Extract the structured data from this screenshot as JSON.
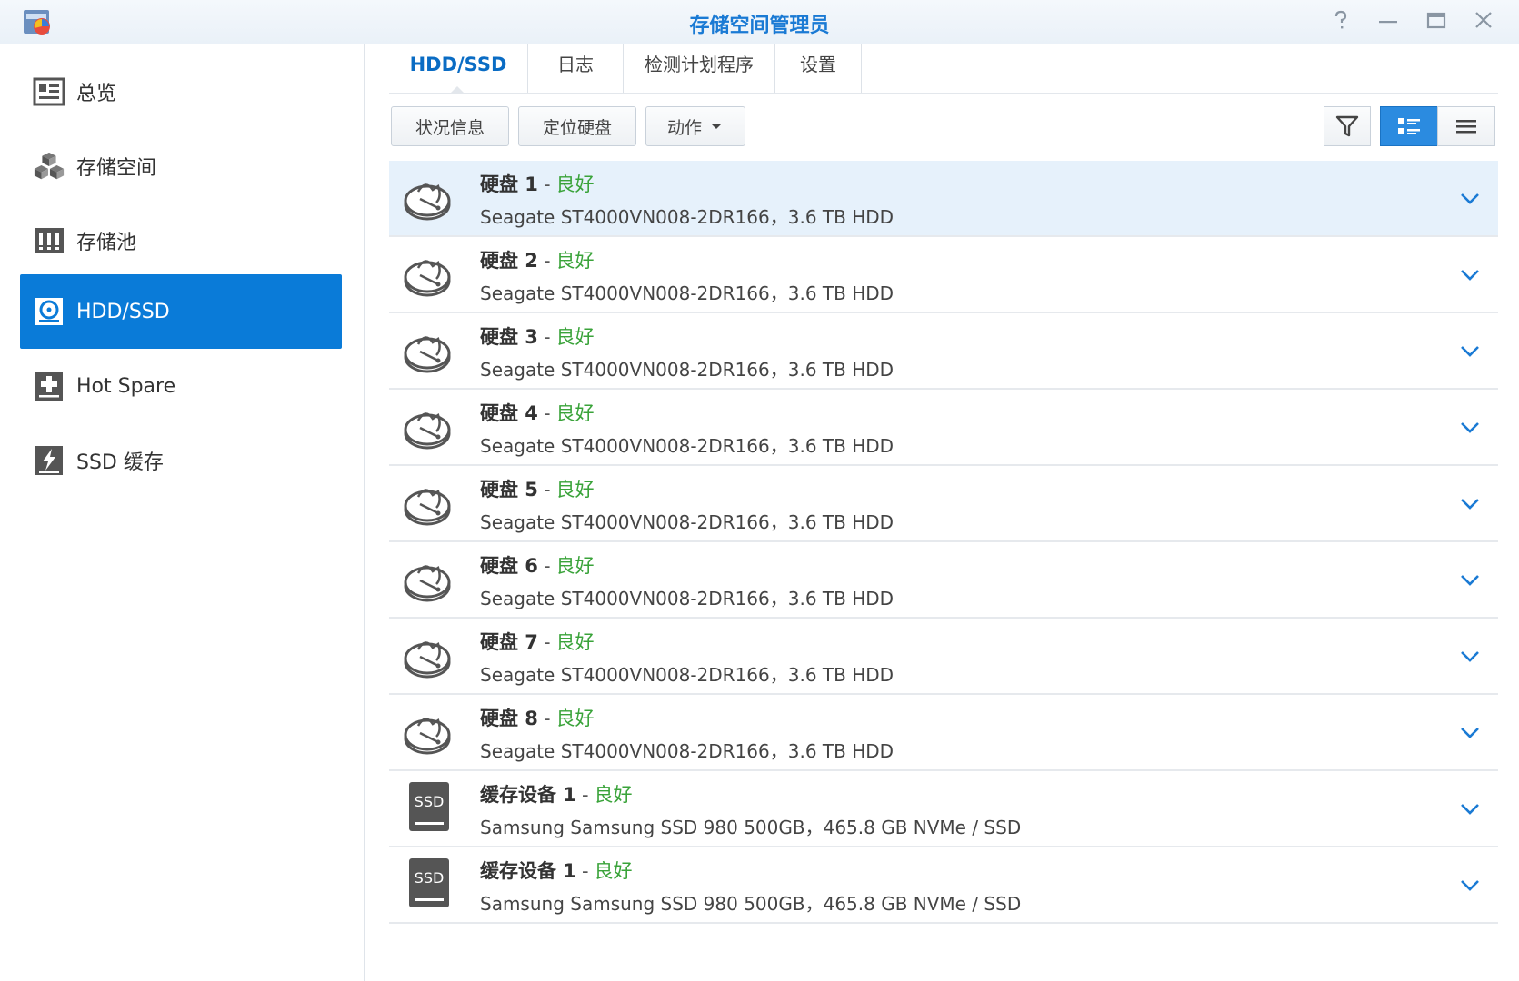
{
  "window": {
    "title": "存储空间管理员",
    "controls": [
      "help-icon",
      "minimize-icon",
      "maximize-icon",
      "close-icon"
    ]
  },
  "sidebar": {
    "items": [
      {
        "label": "总览",
        "icon": "overview-icon",
        "active": false
      },
      {
        "label": "存储空间",
        "icon": "cubes-icon",
        "active": false
      },
      {
        "label": "存储池",
        "icon": "pool-icon",
        "active": false
      },
      {
        "label": "HDD/SSD",
        "icon": "disk-icon",
        "active": true
      },
      {
        "label": "Hot Spare",
        "icon": "plus-box-icon",
        "active": false
      },
      {
        "label": "SSD 缓存",
        "icon": "flash-icon",
        "active": false
      }
    ]
  },
  "tabs": [
    {
      "label": "HDD/SSD",
      "active": true
    },
    {
      "label": "日志",
      "active": false
    },
    {
      "label": "检测计划程序",
      "active": false
    },
    {
      "label": "设置",
      "active": false
    }
  ],
  "toolbar": {
    "status_info": "状况信息",
    "locate_disk": "定位硬盘",
    "action": "动作",
    "tools": [
      "filter-icon",
      "detail-view-icon",
      "list-view-icon"
    ]
  },
  "accent_color": "#0a7bd8",
  "status_color": "#3aa33a",
  "devices": [
    {
      "name": "硬盘 1",
      "status": "良好",
      "detail": "Seagate ST4000VN008-2DR166，3.6 TB HDD",
      "type": "hdd",
      "selected": true
    },
    {
      "name": "硬盘 2",
      "status": "良好",
      "detail": "Seagate ST4000VN008-2DR166，3.6 TB HDD",
      "type": "hdd",
      "selected": false
    },
    {
      "name": "硬盘 3",
      "status": "良好",
      "detail": "Seagate ST4000VN008-2DR166，3.6 TB HDD",
      "type": "hdd",
      "selected": false
    },
    {
      "name": "硬盘 4",
      "status": "良好",
      "detail": "Seagate ST4000VN008-2DR166，3.6 TB HDD",
      "type": "hdd",
      "selected": false
    },
    {
      "name": "硬盘 5",
      "status": "良好",
      "detail": "Seagate ST4000VN008-2DR166，3.6 TB HDD",
      "type": "hdd",
      "selected": false
    },
    {
      "name": "硬盘 6",
      "status": "良好",
      "detail": "Seagate ST4000VN008-2DR166，3.6 TB HDD",
      "type": "hdd",
      "selected": false
    },
    {
      "name": "硬盘 7",
      "status": "良好",
      "detail": "Seagate ST4000VN008-2DR166，3.6 TB HDD",
      "type": "hdd",
      "selected": false
    },
    {
      "name": "硬盘 8",
      "status": "良好",
      "detail": "Seagate ST4000VN008-2DR166，3.6 TB HDD",
      "type": "hdd",
      "selected": false
    },
    {
      "name": "缓存设备 1",
      "status": "良好",
      "detail": "Samsung Samsung SSD 980 500GB，465.8 GB NVMe / SSD",
      "type": "ssd",
      "icon_text": "SSD",
      "selected": false
    },
    {
      "name": "缓存设备 1",
      "status": "良好",
      "detail": "Samsung Samsung SSD 980 500GB，465.8 GB NVMe / SSD",
      "type": "ssd",
      "icon_text": "SSD",
      "selected": false
    }
  ]
}
